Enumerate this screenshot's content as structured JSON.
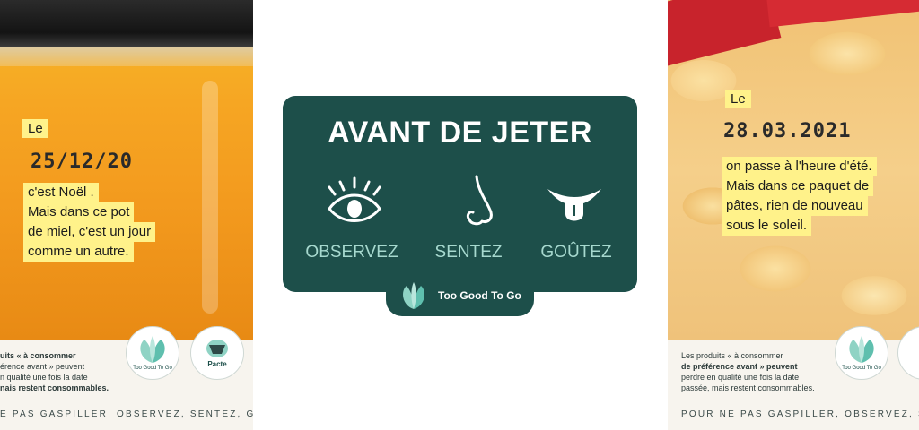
{
  "left_poster": {
    "label_le": "Le",
    "date_stamp": "25/12/20",
    "body_lines": [
      "c'est Noël .",
      "Mais dans ce pot",
      "de miel, c'est un jour",
      "comme un autre."
    ],
    "info_lines": [
      "uits « à consommer",
      "érence avant » peuvent",
      "n qualité une fois la date",
      "nais restent consommables."
    ],
    "logo_tgtg": "Too Good To Go",
    "logo_pacte": "Pacte",
    "tagline": "E PAS GASPILLER, OBSERVEZ, SENTEZ, GOUTEZ."
  },
  "center_card": {
    "title": "AVANT DE JETER",
    "actions": [
      {
        "label": "OBSERVEZ",
        "icon": "eye-icon"
      },
      {
        "label": "SENTEZ",
        "icon": "nose-icon"
      },
      {
        "label": "GOÛTEZ",
        "icon": "tongue-icon"
      }
    ],
    "brand": "Too Good To Go"
  },
  "right_poster": {
    "label_le": "Le",
    "date_stamp": "28.03.2021",
    "body_lines": [
      "on passe à l'heure d'été.",
      "Mais dans ce paquet de",
      "pâtes, rien de nouveau",
      "sous le soleil."
    ],
    "info_lines": [
      "Les produits « à consommer",
      "de préférence avant » peuvent",
      "perdre en qualité une fois la date",
      "passée, mais restent consommables."
    ],
    "logo_tgtg": "Too Good To Go",
    "tagline": "POUR NE PAS GASPILLER, OBSERVEZ, SENTEZ, G"
  },
  "colors": {
    "brand_green": "#1d4f4a",
    "mint": "#a7d9cf",
    "highlight": "#fff28a",
    "honey": "#f6a623"
  }
}
